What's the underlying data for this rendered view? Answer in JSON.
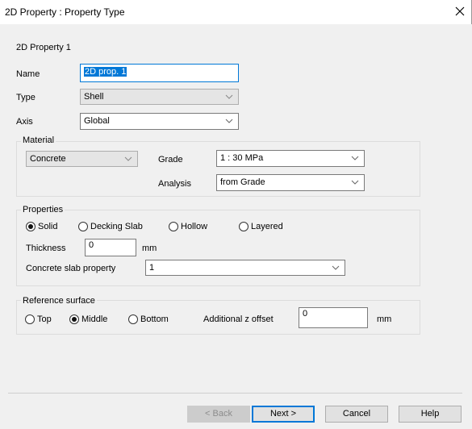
{
  "window": {
    "title": "2D Property : Property Type"
  },
  "header": {
    "property_label": "2D Property 1"
  },
  "form": {
    "name_label": "Name",
    "name_value": "2D prop. 1",
    "type_label": "Type",
    "type_value": "Shell",
    "axis_label": "Axis",
    "axis_value": "Global"
  },
  "material": {
    "title": "Material",
    "material_value": "Concrete",
    "grade_label": "Grade",
    "grade_value": "1 : 30 MPa",
    "analysis_label": "Analysis",
    "analysis_value": "from Grade"
  },
  "properties": {
    "title": "Properties",
    "options": [
      {
        "label": "Solid",
        "selected": true
      },
      {
        "label": "Decking Slab",
        "selected": false
      },
      {
        "label": "Hollow",
        "selected": false
      },
      {
        "label": "Layered",
        "selected": false
      }
    ],
    "thickness_label": "Thickness",
    "thickness_value": "0",
    "thickness_unit": "mm",
    "slab_label": "Concrete slab property",
    "slab_value": "1"
  },
  "reference": {
    "title": "Reference surface",
    "options": [
      {
        "label": "Top",
        "selected": false
      },
      {
        "label": "Middle",
        "selected": true
      },
      {
        "label": "Bottom",
        "selected": false
      }
    ],
    "offset_label": "Additional z offset",
    "offset_value": "0",
    "offset_unit": "mm"
  },
  "buttons": {
    "back": "< Back",
    "next": "Next >",
    "cancel": "Cancel",
    "help": "Help"
  }
}
